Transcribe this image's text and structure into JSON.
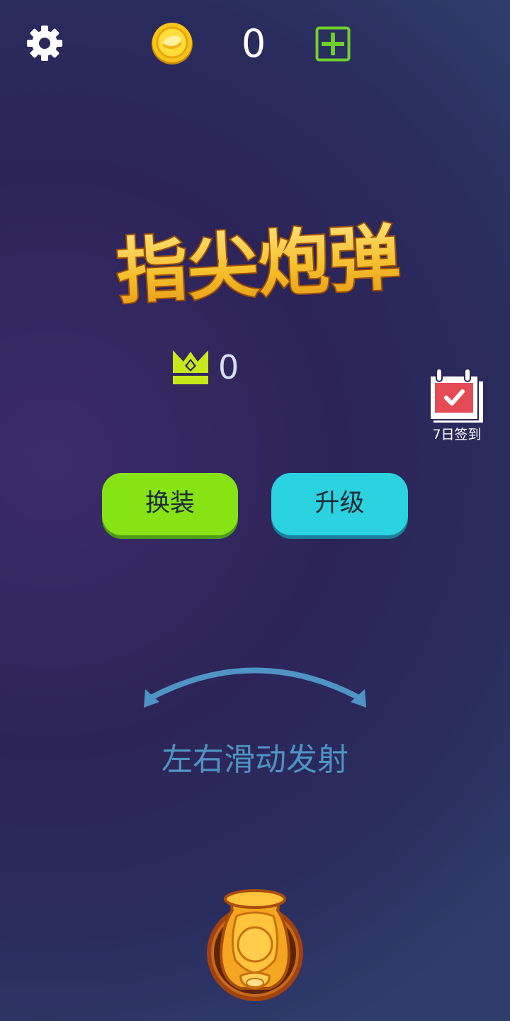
{
  "header": {
    "settings_icon": "gear-icon",
    "coin_icon": "gold-coin-icon",
    "coin_count": "0",
    "add_icon": "plus-square-icon"
  },
  "logo": {
    "text": "指尖炮弹"
  },
  "best_score": {
    "icon": "crown-icon",
    "value": "0"
  },
  "daily_signin": {
    "icon": "calendar-check-icon",
    "label": "7日签到"
  },
  "buttons": {
    "skin_label": "换装",
    "upgrade_label": "升级"
  },
  "hint": {
    "icon": "curved-double-arrow-icon",
    "text": "左右滑动发射"
  },
  "cannon": {
    "icon": "cannon-icon"
  },
  "colors": {
    "background": "#2c2458",
    "skin_button": "#86e414",
    "upgrade_button": "#2bd2df",
    "add_icon": "#6fcf2a",
    "crown": "#c7e81a",
    "hint_text": "#4e94c4",
    "title_gold": "#f3c02e"
  }
}
